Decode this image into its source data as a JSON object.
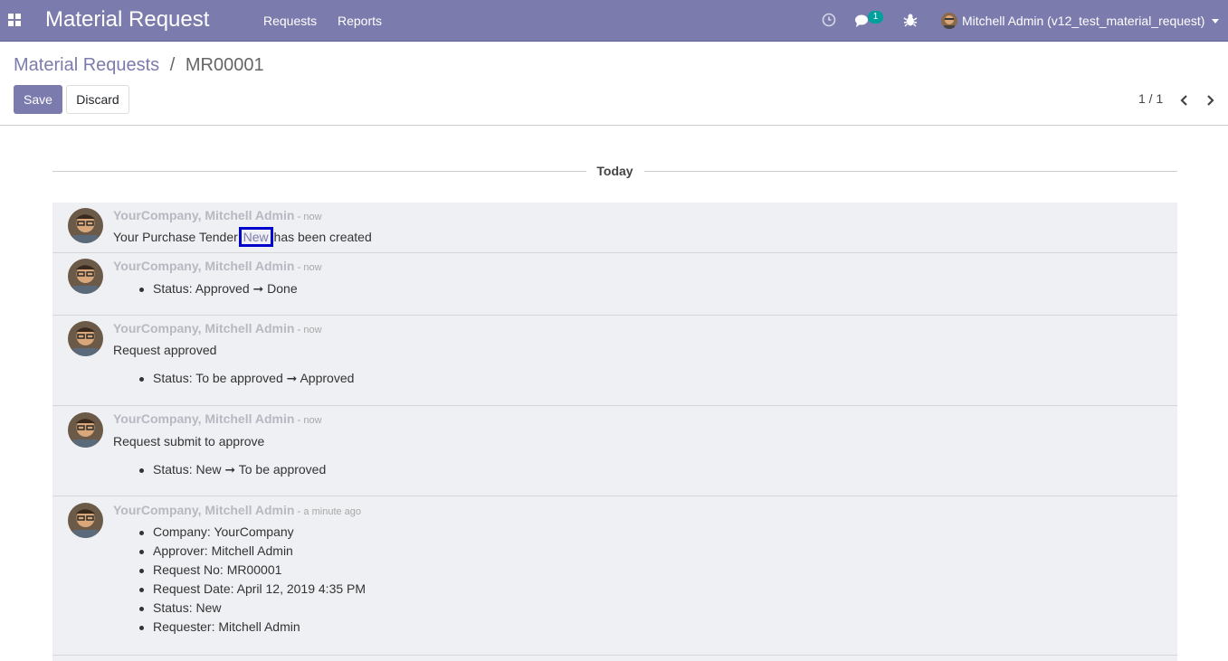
{
  "navbar": {
    "app_title": "Material Request",
    "menu": [
      "Requests",
      "Reports"
    ],
    "chat_badge": "1",
    "user_name": "Mitchell Admin (v12_test_material_request)"
  },
  "breadcrumb": {
    "parent": "Material Requests",
    "separator": "/",
    "current": "MR00001"
  },
  "buttons": {
    "save": "Save",
    "discard": "Discard"
  },
  "pager": {
    "value": "1 / 1"
  },
  "chatter": {
    "day_label": "Today",
    "messages": [
      {
        "author": "YourCompany, Mitchell Admin",
        "dash": "-",
        "date": "now",
        "body_prefix": "Your Purchase Tender ",
        "body_link": "New",
        "body_suffix": " has been created"
      },
      {
        "author": "YourCompany, Mitchell Admin",
        "dash": "-",
        "date": "now",
        "tracking": [
          "Status: Approved ➞ Done"
        ]
      },
      {
        "author": "YourCompany, Mitchell Admin",
        "dash": "-",
        "date": "now",
        "body": "Request approved",
        "tracking": [
          "Status: To be approved ➞ Approved"
        ]
      },
      {
        "author": "YourCompany, Mitchell Admin",
        "dash": "-",
        "date": "now",
        "body": "Request submit to approve",
        "tracking": [
          "Status: New ➞ To be approved"
        ]
      },
      {
        "author": "YourCompany, Mitchell Admin",
        "dash": "-",
        "date": "a minute ago",
        "tracking": [
          "Company: YourCompany",
          "Approver: Mitchell Admin",
          "Request No: MR00001",
          "Request Date: April 12, 2019 4:35 PM",
          "Status: New",
          "Requester: Mitchell Admin"
        ]
      }
    ]
  },
  "colors": {
    "brand": "#7c7bad",
    "message_bg": "#eff0f3",
    "badge": "#00a09d",
    "highlight": "#0000cc"
  },
  "icons": [
    "apps-icon",
    "clock-icon",
    "chat-icon",
    "bug-icon",
    "chevron-left-icon",
    "chevron-right-icon"
  ]
}
